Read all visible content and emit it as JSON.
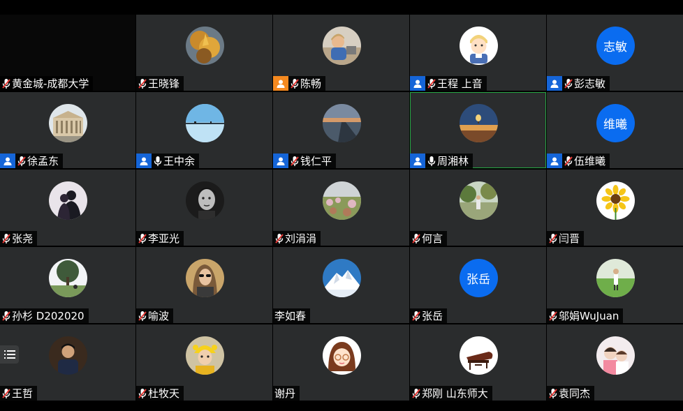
{
  "colors": {
    "tile_bg": "#2a2c2d",
    "name_bg": "#000000",
    "role_badge": "#1565d8",
    "host_badge": "#f5891f",
    "muted_mic": "#e53935",
    "active_border": "#27a744",
    "text_avatar_bg": "#0a6cf0"
  },
  "participants": [
    {
      "name": "黄金城-成都大学",
      "avatar": "none",
      "mic": "muted",
      "badge": "none"
    },
    {
      "name": "王晓锋",
      "avatar": "photo-autumn-leaves",
      "mic": "muted",
      "badge": "none"
    },
    {
      "name": "陈畅",
      "avatar": "photo-child",
      "mic": "muted",
      "badge": "host"
    },
    {
      "name": "王程 上音",
      "avatar": "cartoon-boy",
      "mic": "muted",
      "badge": "user"
    },
    {
      "name": "彭志敏",
      "avatar_text": "志敏",
      "mic": "muted",
      "badge": "user"
    },
    {
      "name": "徐孟东",
      "avatar": "photo-building",
      "mic": "muted",
      "badge": "user"
    },
    {
      "name": "王中余",
      "avatar": "photo-lake",
      "mic": "on",
      "badge": "user"
    },
    {
      "name": "钱仁平",
      "avatar": "photo-pier-sunset",
      "mic": "muted",
      "badge": "user"
    },
    {
      "name": "周湘林",
      "avatar": "photo-balloon",
      "mic": "on",
      "badge": "user",
      "active": true
    },
    {
      "name": "伍维曦",
      "avatar_text": "维曦",
      "mic": "muted",
      "badge": "user"
    },
    {
      "name": "张尧",
      "avatar": "photo-silhouette",
      "mic": "muted",
      "badge": "none"
    },
    {
      "name": "李亚光",
      "avatar": "photo-bw-portrait",
      "mic": "muted",
      "badge": "none"
    },
    {
      "name": "刘涓涓",
      "avatar": "photo-garden",
      "mic": "muted",
      "badge": "none"
    },
    {
      "name": "何言",
      "avatar": "photo-trees",
      "mic": "muted",
      "badge": "none"
    },
    {
      "name": "闫晋",
      "avatar": "photo-sunflower",
      "mic": "muted",
      "badge": "none"
    },
    {
      "name": "孙杉 D202020",
      "avatar": "photo-tree-sky",
      "mic": "muted",
      "badge": "none"
    },
    {
      "name": "喻波",
      "avatar": "photo-woman-sunglasses",
      "mic": "muted",
      "badge": "none"
    },
    {
      "name": "李如春",
      "avatar": "photo-snow-mountain",
      "mic": "none",
      "badge": "none"
    },
    {
      "name": "张岳",
      "avatar_text": "张岳",
      "mic": "muted",
      "badge": "none"
    },
    {
      "name": "邬娟WuJuan",
      "avatar": "photo-grass-field",
      "mic": "muted",
      "badge": "none"
    },
    {
      "name": "王哲",
      "avatar": "photo-man-dark",
      "mic": "muted",
      "badge": "none"
    },
    {
      "name": "杜牧天",
      "avatar": "photo-yellow-hat",
      "mic": "muted",
      "badge": "none"
    },
    {
      "name": "谢丹",
      "avatar": "cartoon-girl",
      "mic": "none",
      "badge": "none"
    },
    {
      "name": "郑刚  山东师大",
      "avatar": "photo-piano",
      "mic": "muted",
      "badge": "none"
    },
    {
      "name": "袁同杰",
      "avatar": "photo-children",
      "mic": "muted",
      "badge": "none"
    }
  ],
  "controls": {
    "menu_icon": "list-menu-icon"
  }
}
